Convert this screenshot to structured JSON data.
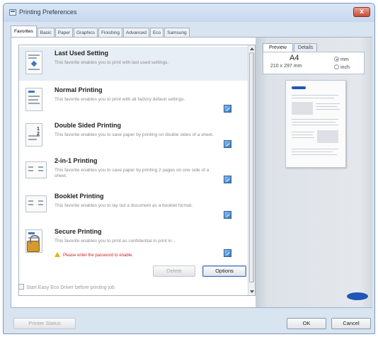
{
  "window": {
    "title": "Printing Preferences",
    "close_label": "x"
  },
  "tabs": [
    "Favorites",
    "Basic",
    "Paper",
    "Graphics",
    "Finishing",
    "Advanced",
    "Eco",
    "Samsung"
  ],
  "favorites": [
    {
      "title": "Last Used Setting",
      "desc": "This favorite enables you to print with last used settings."
    },
    {
      "title": "Normal Printing",
      "desc": "This favorite enables you to print with all factory default settings."
    },
    {
      "title": "Double Sided Printing",
      "desc": "This favorite enables you to save paper by printing on double sides of a sheet."
    },
    {
      "title": "2-in-1 Printing",
      "desc": "This favorite enables you to save paper by printing 2 pages on one side of a sheet."
    },
    {
      "title": "Booklet Printing",
      "desc": "This favorite enables you to lay out a document as a booklet format."
    },
    {
      "title": "Secure Printing",
      "desc": "This favorite enables you to print as confidential in print in...",
      "warning": "Please enter the password to enable."
    }
  ],
  "double_sided_badge": "1 2",
  "buttons": {
    "delete": "Delete",
    "options": "Options",
    "printer_status": "Printer Status",
    "ok": "OK",
    "cancel": "Cancel"
  },
  "eco": {
    "label": "Start Easy Eco Driver before printing job"
  },
  "preview": {
    "tabs": [
      "Preview",
      "Details"
    ],
    "paper_size": "A4",
    "dimensions": "210 x 297 mm",
    "units": [
      {
        "label": "mm",
        "selected": true
      },
      {
        "label": "inch",
        "selected": false
      }
    ]
  },
  "colors": {
    "accent": "#1e57b4",
    "warning": "#cc2222",
    "window_bg": "#d9e4f1"
  }
}
